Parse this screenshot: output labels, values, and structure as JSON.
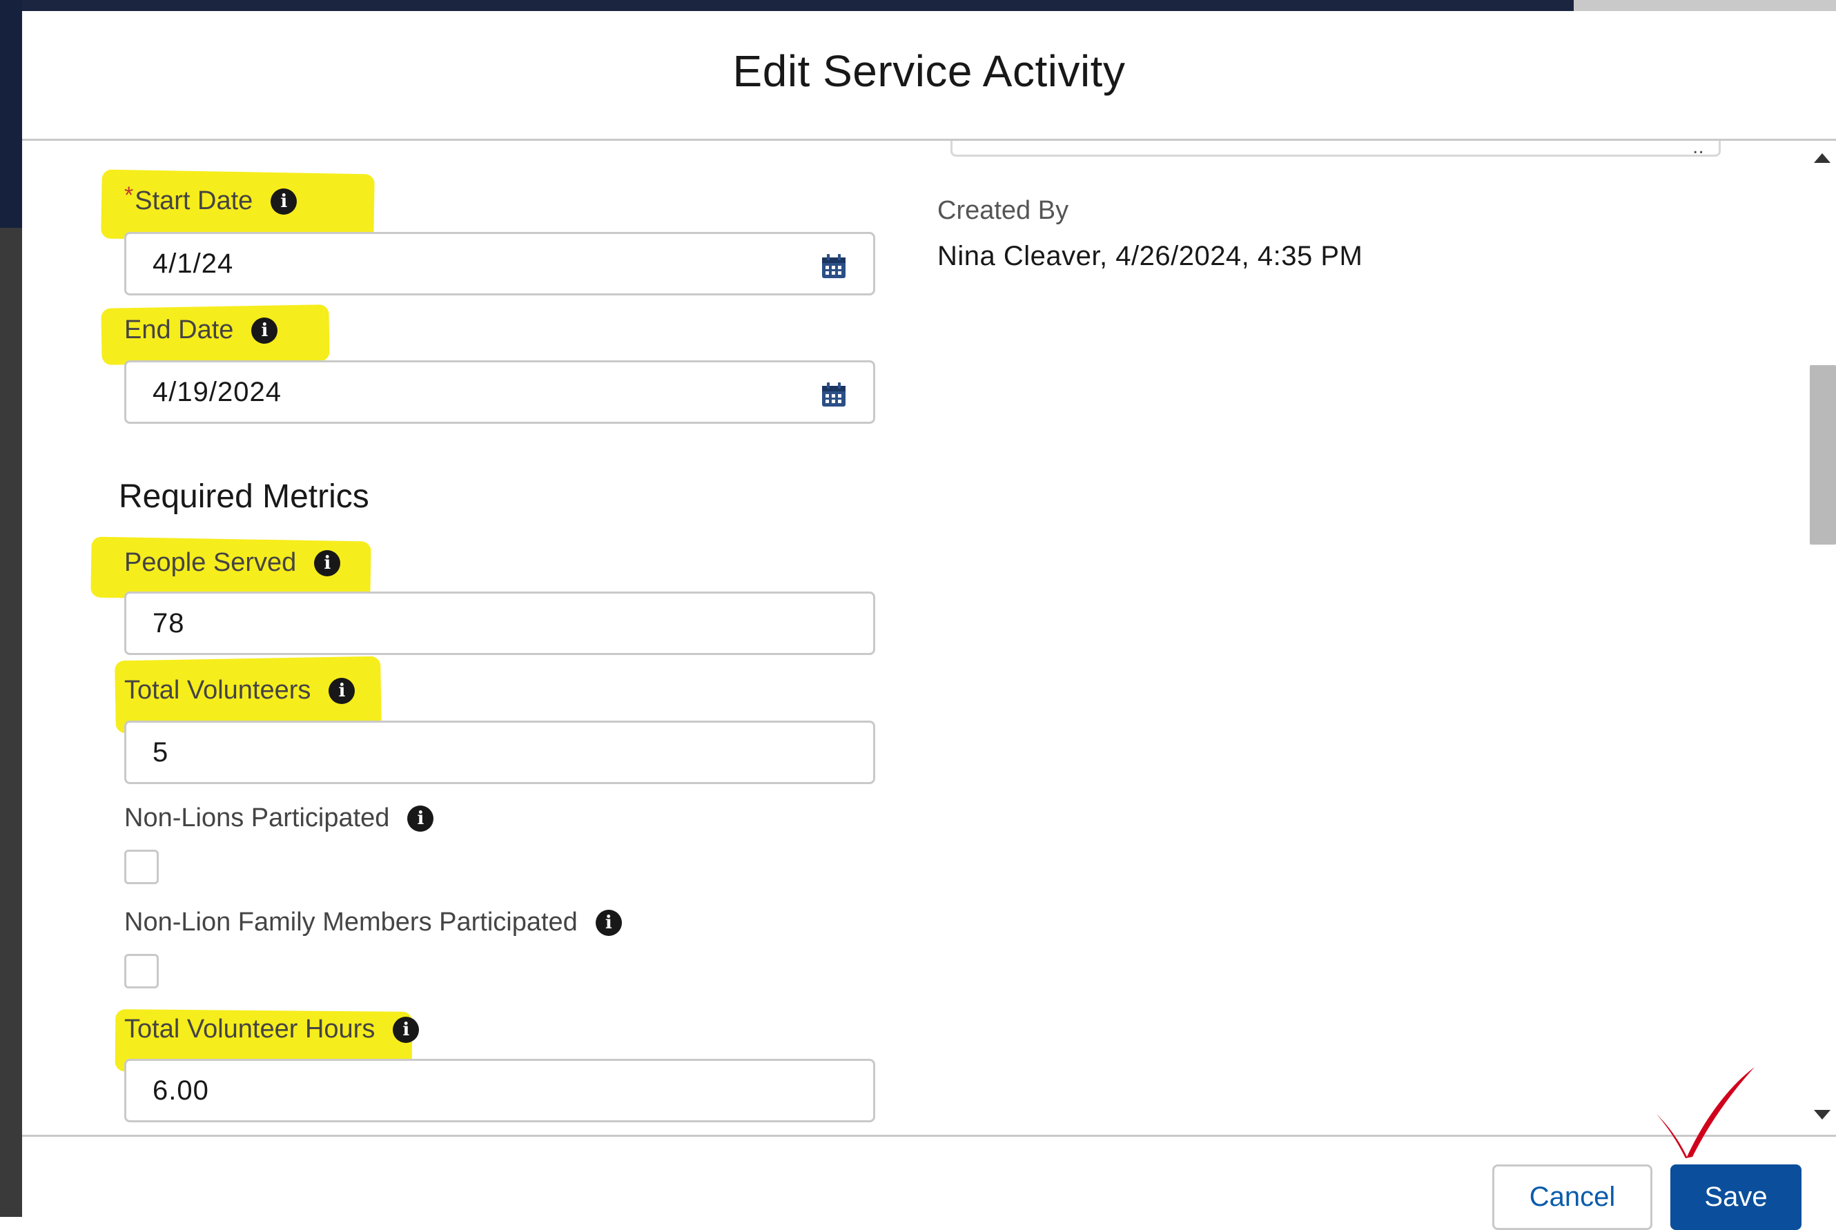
{
  "modal": {
    "title": "Edit Service Activity"
  },
  "fields": {
    "start_date": {
      "label": "Start Date",
      "required": true,
      "value": "4/1/24"
    },
    "end_date": {
      "label": "End Date",
      "value": "4/19/2024"
    },
    "people_served": {
      "label": "People Served",
      "value": "78"
    },
    "total_volunteers": {
      "label": "Total Volunteers",
      "value": "5"
    },
    "non_lions": {
      "label": "Non-Lions Participated",
      "checked": false
    },
    "non_lion_family": {
      "label": "Non-Lion Family Members Participated",
      "checked": false
    },
    "total_volunteer_hours": {
      "label": "Total Volunteer Hours",
      "value": "6.00"
    }
  },
  "section": {
    "required_metrics": "Required Metrics"
  },
  "created_by": {
    "label": "Created By",
    "value": "Nina Cleaver, 4/26/2024, 4:35 PM"
  },
  "footer": {
    "cancel_label": "Cancel",
    "save_label": "Save"
  },
  "colors": {
    "highlight": "#f6ec10",
    "save_button": "#0b4f9c",
    "checkmark": "#d0021b"
  },
  "icons": {
    "info": "info-icon",
    "calendar": "calendar-icon",
    "checkmark": "checkmark-annotation"
  }
}
